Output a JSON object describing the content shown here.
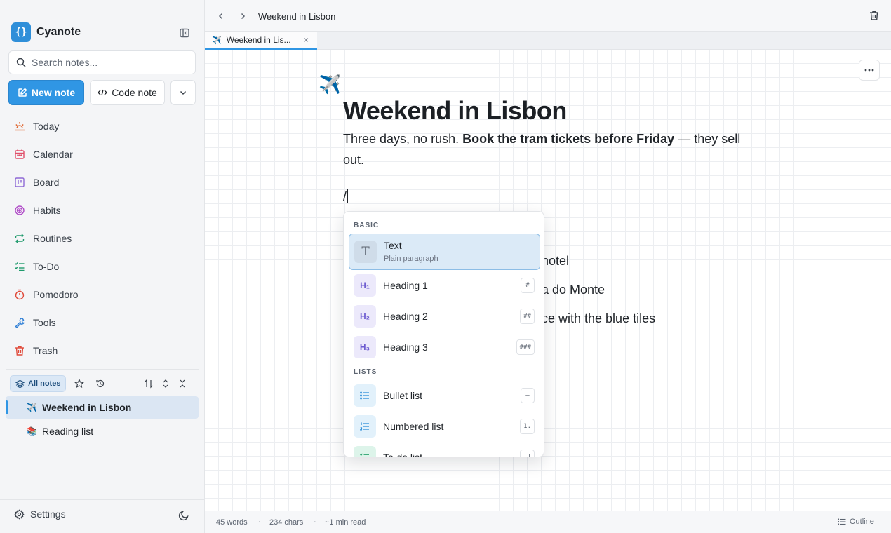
{
  "app": {
    "name": "Cyanote",
    "logo_glyph": "{}",
    "brand_color": "#3096e4"
  },
  "sidebar": {
    "search_placeholder": "Search notes...",
    "new_note_label": "New note",
    "code_note_label": "Code note",
    "nav": [
      {
        "label": "Today",
        "icon": "sun-horizon-icon",
        "color": "#e0662f"
      },
      {
        "label": "Calendar",
        "icon": "calendar-icon",
        "color": "#e04f6a"
      },
      {
        "label": "Board",
        "icon": "board-icon",
        "color": "#8f6ad6"
      },
      {
        "label": "Habits",
        "icon": "target-icon",
        "color": "#b04cc8"
      },
      {
        "label": "Routines",
        "icon": "repeat-icon",
        "color": "#1f9a6c"
      },
      {
        "label": "To-Do",
        "icon": "checklist-icon",
        "color": "#1f9a6c"
      },
      {
        "label": "Pomodoro",
        "icon": "timer-icon",
        "color": "#e04a3a"
      },
      {
        "label": "Tools",
        "icon": "wrench-icon",
        "color": "#2f7fd6"
      },
      {
        "label": "Trash",
        "icon": "trash-icon",
        "color": "#e04a3a"
      }
    ],
    "all_notes_label": "All notes",
    "tree": [
      {
        "emoji": "✈️",
        "label": "Weekend in Lisbon",
        "active": true
      },
      {
        "emoji": "📚",
        "label": "Reading list",
        "active": false
      }
    ],
    "settings_label": "Settings"
  },
  "topbar": {
    "breadcrumb": "Weekend in Lisbon"
  },
  "tab": {
    "emoji": "✈️",
    "label": "Weekend in Lis...",
    "close": "×"
  },
  "document": {
    "emoji": "✈️",
    "title": "Weekend in Lisbon",
    "para_start": "Three days, no rush. ",
    "para_bold": "Book the tram tickets before Friday",
    "para_end": " — they sell out.",
    "slash_text": "/",
    "partial_lines": [
      "hotel",
      "a do Monte",
      "ce with the blue tiles"
    ]
  },
  "slash_menu": {
    "section_basic": "BASIC",
    "section_lists": "LISTS",
    "items": [
      {
        "label": "Text",
        "sub": "Plain paragraph",
        "icon_text": "T",
        "shortcut": ""
      },
      {
        "label": "Heading 1",
        "icon_text": "H₁",
        "shortcut": "#"
      },
      {
        "label": "Heading 2",
        "icon_text": "H₂",
        "shortcut": "##"
      },
      {
        "label": "Heading 3",
        "icon_text": "H₃",
        "shortcut": "###"
      },
      {
        "label": "Bullet list",
        "icon_text": "",
        "shortcut": "–"
      },
      {
        "label": "Numbered list",
        "icon_text": "",
        "shortcut": "1."
      },
      {
        "label": "To-do list",
        "icon_text": "",
        "shortcut": "[]"
      }
    ]
  },
  "statusbar": {
    "words": "45 words",
    "chars": "234 chars",
    "read": "~1 min read",
    "separator": "·",
    "outline_label": "Outline"
  }
}
